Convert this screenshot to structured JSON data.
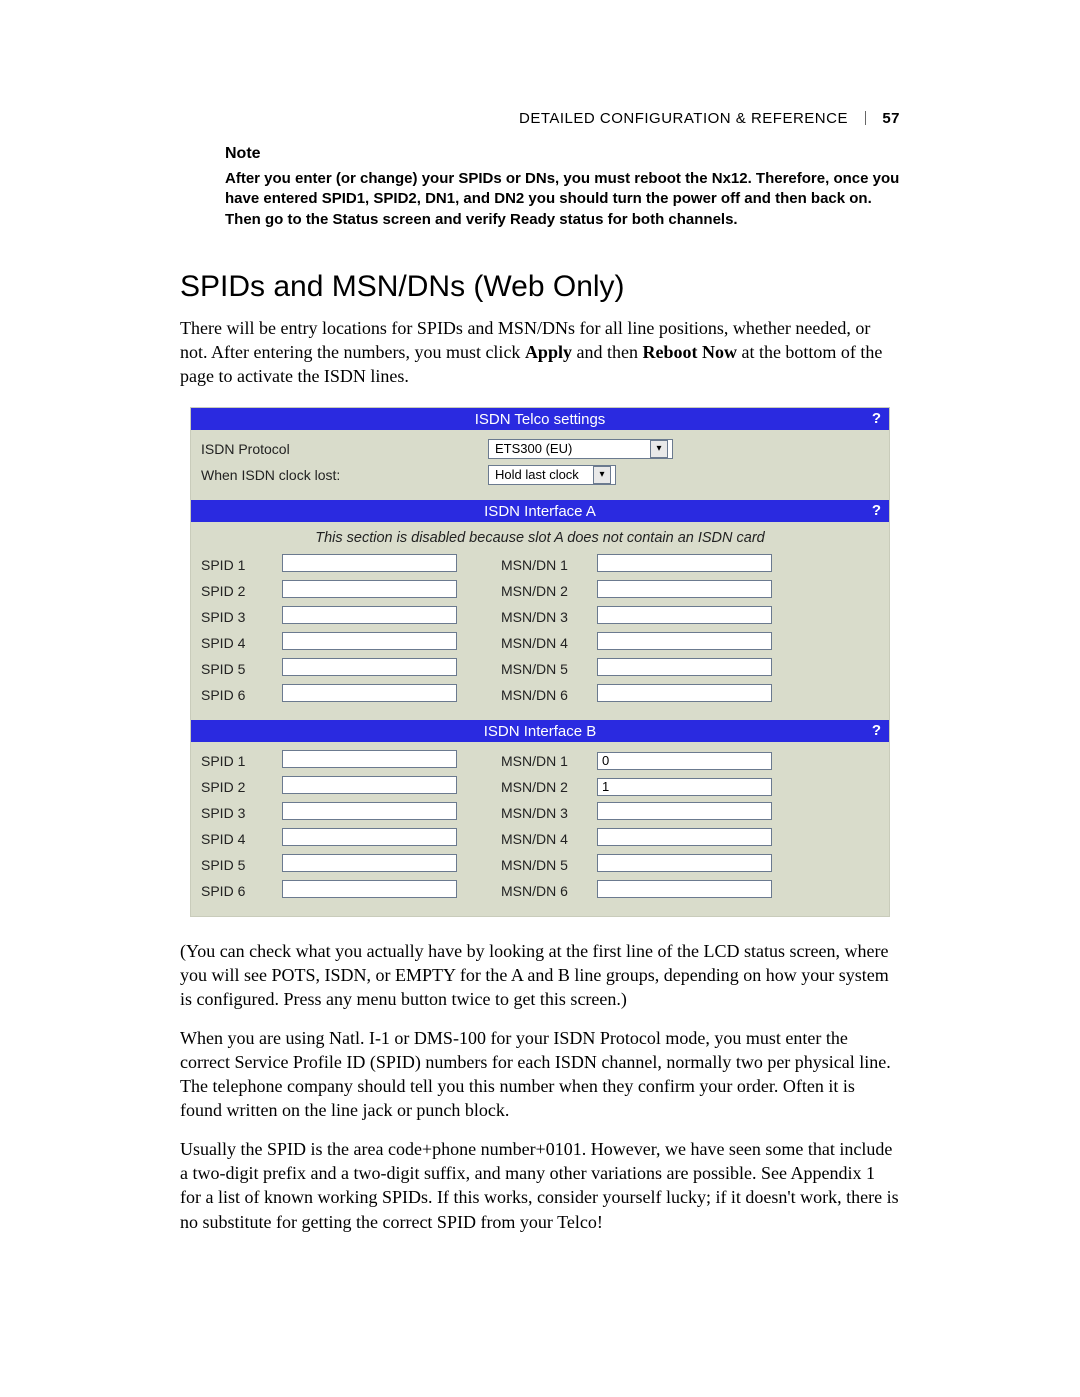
{
  "header": {
    "title": "DETAILED CONFIGURATION & REFERENCE",
    "page": "57"
  },
  "note": {
    "heading": "Note",
    "body": "After you enter (or change) your SPIDs or DNs, you must reboot the Nx12. Therefore, once you have entered SPID1, SPID2, DN1, and DN2 you should turn the power off and then back on. Then go to the Status screen and verify Ready status for both channels."
  },
  "section_title": "SPIDs and MSN/DNs (Web Only)",
  "intro": {
    "pre": "There will be entry locations for SPIDs and MSN/DNs for all line positions, whether needed, or not. After entering the numbers, you must click ",
    "apply": "Apply",
    "mid": " and then ",
    "reboot": "Reboot Now",
    "post": " at the bottom of the page to activate the ISDN lines."
  },
  "panel": {
    "telco": {
      "title": "ISDN Telco settings",
      "help": "?",
      "protocol_label": "ISDN Protocol",
      "protocol_value": "ETS300 (EU)",
      "clock_label": "When ISDN clock lost:",
      "clock_value": "Hold last clock"
    },
    "ifaceA": {
      "title": "ISDN Interface A",
      "help": "?",
      "disabled_msg": "This section is disabled because slot A does not contain an ISDN card",
      "rows": [
        {
          "spid_label": "SPID 1",
          "spid_value": "",
          "msn_label": "MSN/DN 1",
          "msn_value": ""
        },
        {
          "spid_label": "SPID 2",
          "spid_value": "",
          "msn_label": "MSN/DN 2",
          "msn_value": ""
        },
        {
          "spid_label": "SPID 3",
          "spid_value": "",
          "msn_label": "MSN/DN 3",
          "msn_value": ""
        },
        {
          "spid_label": "SPID 4",
          "spid_value": "",
          "msn_label": "MSN/DN 4",
          "msn_value": ""
        },
        {
          "spid_label": "SPID 5",
          "spid_value": "",
          "msn_label": "MSN/DN 5",
          "msn_value": ""
        },
        {
          "spid_label": "SPID 6",
          "spid_value": "",
          "msn_label": "MSN/DN 6",
          "msn_value": ""
        }
      ]
    },
    "ifaceB": {
      "title": "ISDN Interface B",
      "help": "?",
      "rows": [
        {
          "spid_label": "SPID 1",
          "spid_value": "",
          "msn_label": "MSN/DN 1",
          "msn_value": "0"
        },
        {
          "spid_label": "SPID 2",
          "spid_value": "",
          "msn_label": "MSN/DN 2",
          "msn_value": "1"
        },
        {
          "spid_label": "SPID 3",
          "spid_value": "",
          "msn_label": "MSN/DN 3",
          "msn_value": ""
        },
        {
          "spid_label": "SPID 4",
          "spid_value": "",
          "msn_label": "MSN/DN 4",
          "msn_value": ""
        },
        {
          "spid_label": "SPID 5",
          "spid_value": "",
          "msn_label": "MSN/DN 5",
          "msn_value": ""
        },
        {
          "spid_label": "SPID 6",
          "spid_value": "",
          "msn_label": "MSN/DN 6",
          "msn_value": ""
        }
      ]
    }
  },
  "para_lcd": "(You can check what you actually have by looking at the first line of the LCD status screen, where you will see POTS, ISDN, or EMPTY for the A and B line groups, depending on how your system is configured. Press any menu button twice to get this screen.)",
  "para_natl": "When you are using Natl. I-1 or DMS-100 for your ISDN Protocol mode, you must enter the correct Service Profile ID (SPID) numbers for each ISDN channel, normally two per physical line. The telephone company should tell you this number when they confirm your order. Often it is found written on the line jack or punch block.",
  "para_usually": "Usually the SPID is the area code+phone number+0101. However, we have seen some that include a two-digit prefix and a two-digit suffix, and many other variations are possible. See Appendix 1 for a list of known working SPIDs. If this works, consider yourself lucky; if it doesn't work, there is no substitute for getting the correct SPID from your Telco!"
}
